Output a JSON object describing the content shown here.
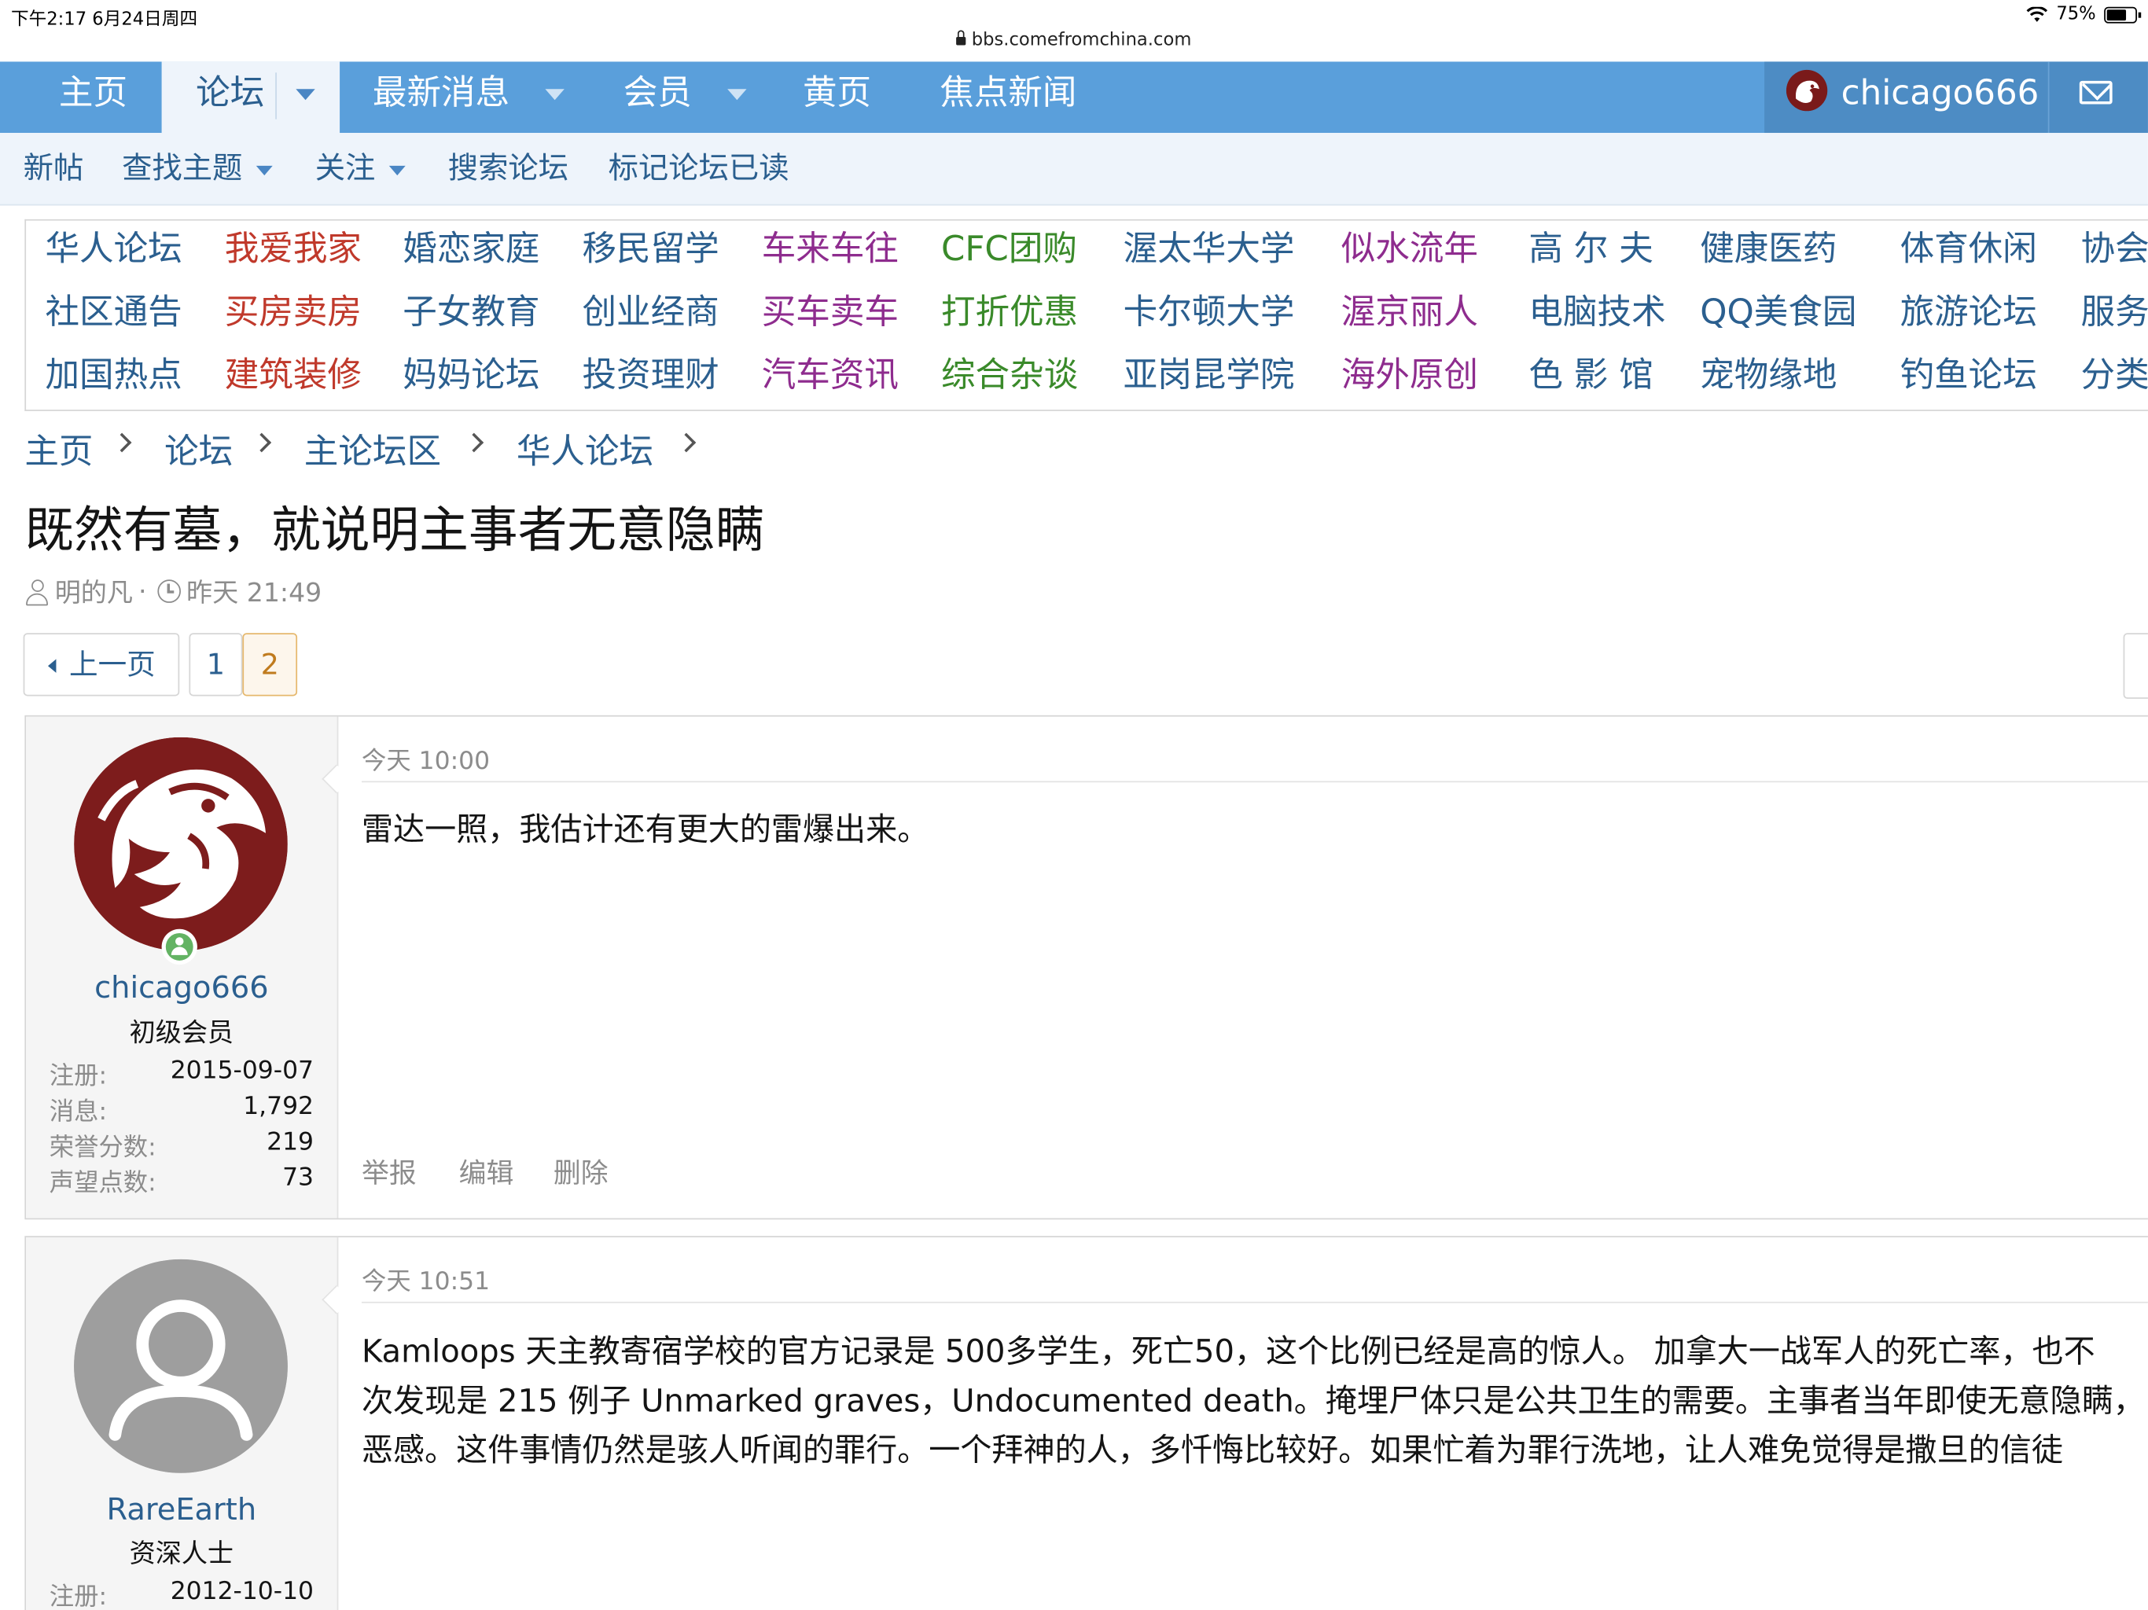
{
  "statusbar": {
    "time": "下午2:17   6月24日周四",
    "battery": "75%",
    "battery_level": 0.75
  },
  "browser": {
    "url": "bbs.comefromchina.com"
  },
  "nav": {
    "home": "主页",
    "forums": "论坛",
    "whats_new": "最新消息",
    "members": "会员",
    "yellow_pages": "黄页",
    "news": "焦点新闻",
    "username": "chicago666"
  },
  "subnav": {
    "new_posts": "新帖",
    "find_threads": "查找主题",
    "watched": "关注",
    "search_forums": "搜索论坛",
    "mark_read": "标记论坛已读"
  },
  "colors": {
    "nav_bar": "#5a9fdb",
    "link": "#2b5f8f",
    "red": "#c0392b",
    "purple": "#8e2c8e",
    "green": "#3a8a2a",
    "blue": "#2b5f8f"
  },
  "forum_grid": [
    [
      "华人论坛",
      "我爱我家",
      "婚恋家庭",
      "移民留学",
      "车来车往",
      "CFC团购",
      "渥太华大学",
      "似水流年",
      "高 尔 夫",
      "健康医药",
      "体育休闲",
      "协会"
    ],
    [
      "社区通告",
      "买房卖房",
      "子女教育",
      "创业经商",
      "买车卖车",
      "打折优惠",
      "卡尔顿大学",
      "渥京丽人",
      "电脑技术",
      "QQ美食园",
      "旅游论坛",
      "服务"
    ],
    [
      "加国热点",
      "建筑装修",
      "妈妈论坛",
      "投资理财",
      "汽车资讯",
      "综合杂谈",
      "亚岗昆学院",
      "海外原创",
      "色 影 馆",
      "宠物缘地",
      "钓鱼论坛",
      "分类"
    ]
  ],
  "breadcrumb": [
    "主页",
    "论坛",
    "主论坛区",
    "华人论坛"
  ],
  "thread": {
    "title": "既然有墓，就说明主事者无意隐瞒",
    "author": "明的凡",
    "separator": "·",
    "time": "昨天 21:49"
  },
  "pagination": {
    "prev": "上一页",
    "pages": [
      "1",
      "2"
    ],
    "current": "2"
  },
  "posts": [
    {
      "username": "chicago666",
      "user_title": "初级会员",
      "stats": [
        {
          "k": "注册:",
          "v": "2015-09-07"
        },
        {
          "k": "消息:",
          "v": "1,792"
        },
        {
          "k": "荣誉分数:",
          "v": "219"
        },
        {
          "k": "声望点数:",
          "v": "73"
        }
      ],
      "time": "今天 10:00",
      "body": [
        "雷达一照，我估计还有更大的雷爆出来。"
      ],
      "actions": [
        "举报",
        "编辑",
        "删除"
      ]
    },
    {
      "username": "RareEarth",
      "user_title": "资深人士",
      "stats": [
        {
          "k": "注册:",
          "v": "2012-10-10"
        }
      ],
      "time": "今天 10:51",
      "body": [
        "Kamloops 天主教寄宿学校的官方记录是 500多学生，死亡50，这个比例已经是高的惊人。 加拿大一战军人的死亡率，也不",
        "次发现是 215 例子 Unmarked graves，Undocumented death。掩埋尸体只是公共卫生的需要。主事者当年即使无意隐瞒，",
        "恶感。这件事情仍然是骇人听闻的罪行。一个拜神的人，多忏悔比较好。如果忙着为罪行洗地，让人难免觉得是撒旦的信徒"
      ]
    }
  ]
}
